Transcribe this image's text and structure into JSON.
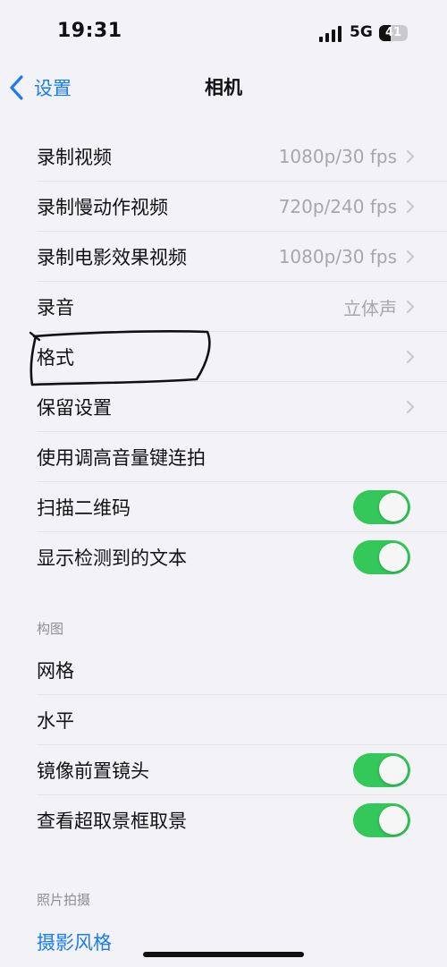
{
  "status_bar": {
    "time": "19:31",
    "network": "5G",
    "battery": "41",
    "battery_level": 0.41
  },
  "nav": {
    "back_label": "设置",
    "title": "相机"
  },
  "group1": [
    {
      "label": "录制视频",
      "value": "1080p/30 fps",
      "type": "chevron"
    },
    {
      "label": "录制慢动作视频",
      "value": "720p/240 fps",
      "type": "chevron"
    },
    {
      "label": "录制电影效果视频",
      "value": "1080p/30 fps",
      "type": "chevron"
    },
    {
      "label": "录音",
      "value": "立体声",
      "type": "chevron"
    },
    {
      "label": "格式",
      "value": "",
      "type": "chevron"
    },
    {
      "label": "保留设置",
      "value": "",
      "type": "chevron"
    },
    {
      "label": "使用调高音量键连拍",
      "value": "",
      "type": "none"
    },
    {
      "label": "扫描二维码",
      "value": "",
      "type": "toggle",
      "on": true
    },
    {
      "label": "显示检测到的文本",
      "value": "",
      "type": "toggle",
      "on": true
    }
  ],
  "section_composition": "构图",
  "group2": [
    {
      "label": "网格",
      "type": "none"
    },
    {
      "label": "水平",
      "type": "none"
    },
    {
      "label": "镜像前置镜头",
      "type": "toggle",
      "on": true
    },
    {
      "label": "查看超取景框取景",
      "type": "toggle",
      "on": true
    }
  ],
  "section_photo": "照片拍摄",
  "photo_style_label": "摄影风格",
  "colors": {
    "accent": "#1a7cf0",
    "toggle_on": "#34c759",
    "background": "#f2f2f7",
    "value_text": "#a6a6ad"
  },
  "icons": {
    "back": "chevron-left-icon",
    "row": "chevron-right-icon",
    "signal": "cellular-signal-icon",
    "battery": "battery-icon"
  }
}
